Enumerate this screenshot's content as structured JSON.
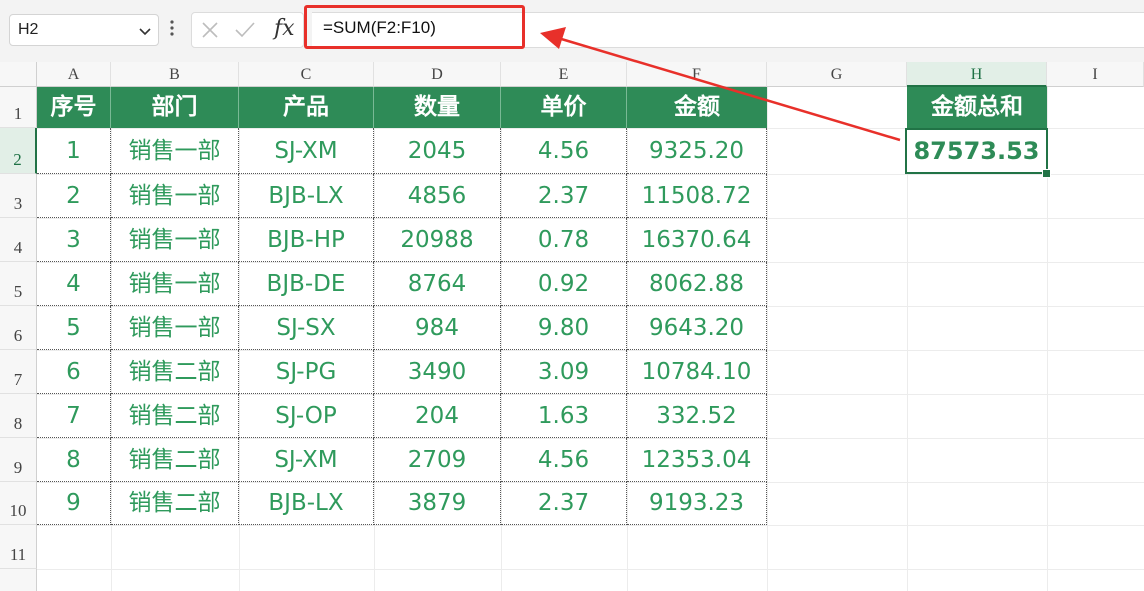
{
  "formula_bar": {
    "name_box": "H2",
    "fx_label": "fx",
    "formula": "=SUM(F2:F10)"
  },
  "columns": [
    "A",
    "B",
    "C",
    "D",
    "E",
    "F",
    "G",
    "H",
    "I"
  ],
  "rows": [
    "1",
    "2",
    "3",
    "4",
    "5",
    "6",
    "7",
    "8",
    "9",
    "10",
    "11"
  ],
  "table": {
    "headers": [
      "序号",
      "部门",
      "产品",
      "数量",
      "单价",
      "金额"
    ],
    "rows": [
      [
        "1",
        "销售一部",
        "SJ-XM",
        "2045",
        "4.56",
        "9325.20"
      ],
      [
        "2",
        "销售一部",
        "BJB-LX",
        "4856",
        "2.37",
        "11508.72"
      ],
      [
        "3",
        "销售一部",
        "BJB-HP",
        "20988",
        "0.78",
        "16370.64"
      ],
      [
        "4",
        "销售一部",
        "BJB-DE",
        "8764",
        "0.92",
        "8062.88"
      ],
      [
        "5",
        "销售一部",
        "SJ-SX",
        "984",
        "9.80",
        "9643.20"
      ],
      [
        "6",
        "销售二部",
        "SJ-PG",
        "3490",
        "3.09",
        "10784.10"
      ],
      [
        "7",
        "销售二部",
        "SJ-OP",
        "204",
        "1.63",
        "332.52"
      ],
      [
        "8",
        "销售二部",
        "SJ-XM",
        "2709",
        "4.56",
        "12353.04"
      ],
      [
        "9",
        "销售二部",
        "BJB-LX",
        "3879",
        "2.37",
        "9193.23"
      ]
    ]
  },
  "summary": {
    "header": "金额总和",
    "value": "87573.53"
  },
  "colors": {
    "header_green": "#2e8b57",
    "text_green": "#2f9a5c",
    "annotation_red": "#e8302a"
  }
}
